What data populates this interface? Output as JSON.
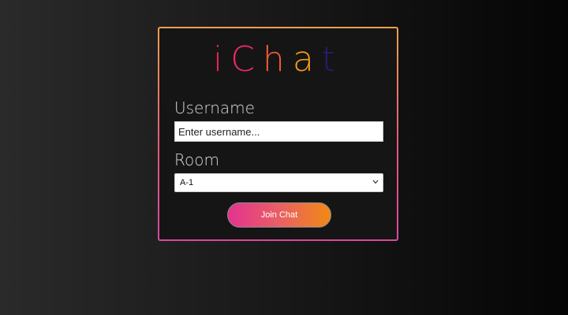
{
  "logo": {
    "letters": [
      "i",
      "C",
      "h",
      "a",
      "t"
    ],
    "colors": [
      "#e8284f",
      "#ef2b62",
      "#f25a3c",
      "#f59a1c",
      "#2b1a7a"
    ]
  },
  "form": {
    "username_label": "Username",
    "username_placeholder": "Enter username...",
    "username_value": "",
    "room_label": "Room",
    "room_selected": "A-1",
    "join_label": "Join Chat"
  },
  "icons": {
    "select_arrow": "chevron-down-icon"
  }
}
